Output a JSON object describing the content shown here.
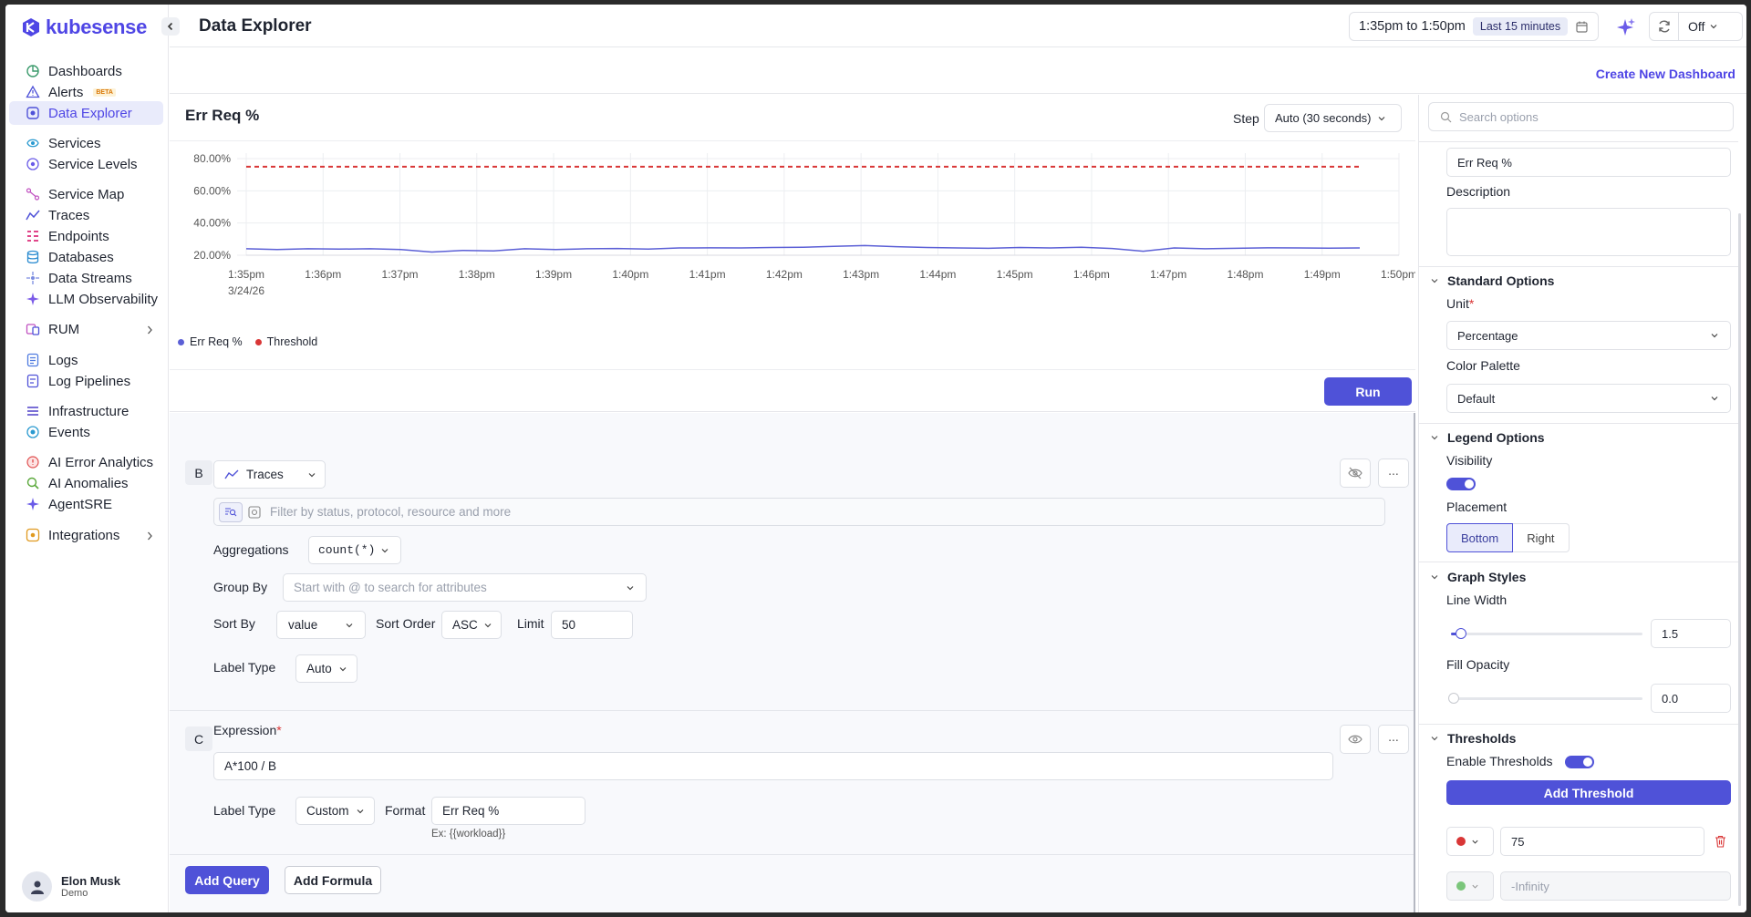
{
  "app": {
    "logo_text": "kubesense",
    "page_title": "Data Explorer"
  },
  "sidebar": {
    "items": [
      {
        "label": "Dashboards",
        "icon": "dashboard-icon"
      },
      {
        "label": "Alerts",
        "badge": "BETA",
        "icon": "alert-icon"
      },
      {
        "label": "Data Explorer",
        "icon": "data-explorer-icon",
        "active": true
      },
      {
        "label": "Services",
        "icon": "services-icon"
      },
      {
        "label": "Service Levels",
        "icon": "service-levels-icon"
      },
      {
        "label": "Service Map",
        "icon": "service-map-icon"
      },
      {
        "label": "Traces",
        "icon": "traces-icon"
      },
      {
        "label": "Endpoints",
        "icon": "endpoints-icon"
      },
      {
        "label": "Databases",
        "icon": "databases-icon"
      },
      {
        "label": "Data Streams",
        "icon": "data-streams-icon"
      },
      {
        "label": "LLM Observability",
        "icon": "llm-icon"
      },
      {
        "label": "RUM",
        "icon": "rum-icon"
      },
      {
        "label": "Logs",
        "icon": "logs-icon"
      },
      {
        "label": "Log Pipelines",
        "icon": "log-pipelines-icon"
      },
      {
        "label": "Infrastructure",
        "icon": "infrastructure-icon"
      },
      {
        "label": "Events",
        "icon": "events-icon"
      },
      {
        "label": "AI Error Analytics",
        "icon": "ai-error-icon"
      },
      {
        "label": "AI Anomalies",
        "icon": "ai-anomalies-icon"
      },
      {
        "label": "AgentSRE",
        "icon": "agentsre-icon"
      },
      {
        "label": "Integrations",
        "icon": "integrations-icon"
      }
    ],
    "user": {
      "name": "Elon Musk",
      "role": "Demo"
    }
  },
  "topbar": {
    "time_range": "1:35pm to 1:50pm",
    "relative": "Last 15 minutes",
    "refresh": "Off"
  },
  "subbar": {
    "create_link": "Create New Dashboard"
  },
  "panel": {
    "title": "Err Req %",
    "step_label": "Step",
    "step_value": "Auto (30 seconds)",
    "run_label": "Run"
  },
  "chart_data": {
    "type": "line",
    "x": [
      "1:35pm",
      "1:36pm",
      "1:37pm",
      "1:38pm",
      "1:39pm",
      "1:40pm",
      "1:41pm",
      "1:42pm",
      "1:43pm",
      "1:44pm",
      "1:45pm",
      "1:46pm",
      "1:47pm",
      "1:48pm",
      "1:49pm",
      "1:50pm"
    ],
    "x_sublabel": "3/24/26",
    "y_ticks": [
      "80.00%",
      "60.00%",
      "40.00%",
      "20.00%"
    ],
    "ylim": [
      20,
      80
    ],
    "grid": true,
    "series": [
      {
        "name": "Err Req %",
        "color": "#5b5fd6",
        "values": [
          24,
          23.5,
          24,
          23.8,
          24,
          23.5,
          22,
          23,
          22.7,
          24,
          23.5,
          24,
          24.2,
          23.8,
          24.5,
          24.6,
          24.5,
          24.8,
          25,
          25.5,
          26,
          25.3,
          24.8,
          24.5,
          24.3,
          24.8,
          24.5,
          25,
          24.2,
          22.5,
          24.5,
          24,
          24.3,
          24.6,
          24.5,
          24.4,
          24.5
        ]
      },
      {
        "name": "Threshold",
        "color": "#d93636",
        "values": [
          75
        ],
        "style": "dashed"
      }
    ],
    "legend_placement": "bottom"
  },
  "query_b": {
    "letter": "B",
    "source": "Traces",
    "filter_placeholder": "Filter by status, protocol, resource and more",
    "aggregations_label": "Aggregations",
    "aggregation": "count(*)",
    "group_by_label": "Group By",
    "group_by_placeholder": "Start with @ to search for attributes",
    "sort_by_label": "Sort By",
    "sort_by": "value",
    "sort_order_label": "Sort Order",
    "sort_order": "ASC",
    "limit_label": "Limit",
    "limit": "50",
    "label_type_label": "Label Type",
    "label_type": "Auto"
  },
  "formula_c": {
    "letter": "C",
    "expression_label": "Expression",
    "expression": "A*100 / B",
    "label_type_label": "Label Type",
    "label_type": "Custom",
    "format_label": "Format",
    "format": "Err Req %",
    "format_hint": "Ex: {{workload}}"
  },
  "actions": {
    "add_query": "Add Query",
    "add_formula": "Add Formula"
  },
  "options": {
    "search_placeholder": "Search options",
    "title_value": "Err Req %",
    "description_label": "Description",
    "standard_options": "Standard Options",
    "unit_label": "Unit",
    "unit_value": "Percentage",
    "palette_label": "Color Palette",
    "palette_value": "Default",
    "legend_options": "Legend Options",
    "visibility_label": "Visibility",
    "visibility_on": true,
    "placement_label": "Placement",
    "placement_bottom": "Bottom",
    "placement_right": "Right",
    "graph_styles": "Graph Styles",
    "line_width_label": "Line Width",
    "line_width": "1.5",
    "fill_opacity_label": "Fill Opacity",
    "fill_opacity": "0.0",
    "thresholds": "Thresholds",
    "enable_thresholds_label": "Enable Thresholds",
    "enable_thresholds_on": true,
    "add_threshold": "Add Threshold",
    "threshold_value": "75",
    "threshold_color": "#d93636",
    "base_placeholder": "-Infinity",
    "base_color": "#7bc67b"
  }
}
